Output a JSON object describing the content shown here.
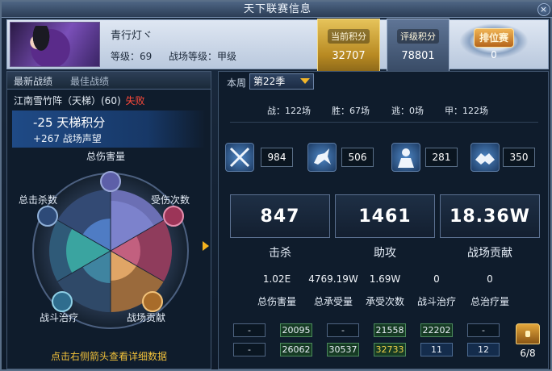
{
  "window": {
    "title": "天下联赛信息",
    "close_icon": "close-icon"
  },
  "player": {
    "name": "青行灯ヾ",
    "level_text": "等级：69",
    "arena_level_text": "战场等级：甲级"
  },
  "badges": {
    "current_label": "当前积分",
    "current_value": "32707",
    "rating_label": "评级积分",
    "rating_value": "78801",
    "ranked_label": "排位赛",
    "ranked_value": "0"
  },
  "left": {
    "tab_recent": "最新战绩",
    "tab_best": "最佳战绩",
    "match_name": "江南雪竹阵（天梯）(60)",
    "match_result": "失败",
    "ladder_points": "-25 天梯积分",
    "arena_fame": "+267 战场声望",
    "radar_labels": {
      "total_damage": "总伤害量",
      "hits_taken": "受伤次数",
      "total_kills": "总击杀数",
      "battle_heal": "战斗治疗",
      "battle_contribution": "战场贡献"
    },
    "hint": "点击右侧箭头查看详细数据"
  },
  "right": {
    "week_label": "本周",
    "season": "第22季",
    "summary": {
      "battles": "战：122场",
      "wins": "胜：67场",
      "escape": "逃：0场",
      "grade_a": "甲：122场"
    },
    "icons": [
      {
        "name": "crossed-swords-icon",
        "value": "984"
      },
      {
        "name": "horse-icon",
        "value": "506"
      },
      {
        "name": "warrior-icon",
        "value": "281"
      },
      {
        "name": "handshake-icon",
        "value": "350"
      }
    ],
    "big_stats": [
      {
        "value": "847",
        "label": "击杀"
      },
      {
        "value": "1461",
        "label": "助攻"
      },
      {
        "value": "18.36W",
        "label": "战场贡献"
      }
    ],
    "mini_stats": [
      {
        "value": "1.02E",
        "label": "总伤害量"
      },
      {
        "value": "4769.19W",
        "label": "总承受量"
      },
      {
        "value": "1.69W",
        "label": "承受次数"
      },
      {
        "value": "0",
        "label": "战斗治疗"
      },
      {
        "value": "0",
        "label": "总治疗量"
      }
    ],
    "grid_row1": [
      "-",
      "20095",
      "-",
      "21558",
      "22202",
      "-"
    ],
    "grid_row2": [
      "-",
      "26062",
      "30537",
      "32733",
      "11",
      "12"
    ],
    "chest_count": "6/8"
  },
  "colors": {
    "accent_gold": "#f3b629",
    "loss_red": "#ff4a3a",
    "hint_yellow": "#f3c23a"
  }
}
